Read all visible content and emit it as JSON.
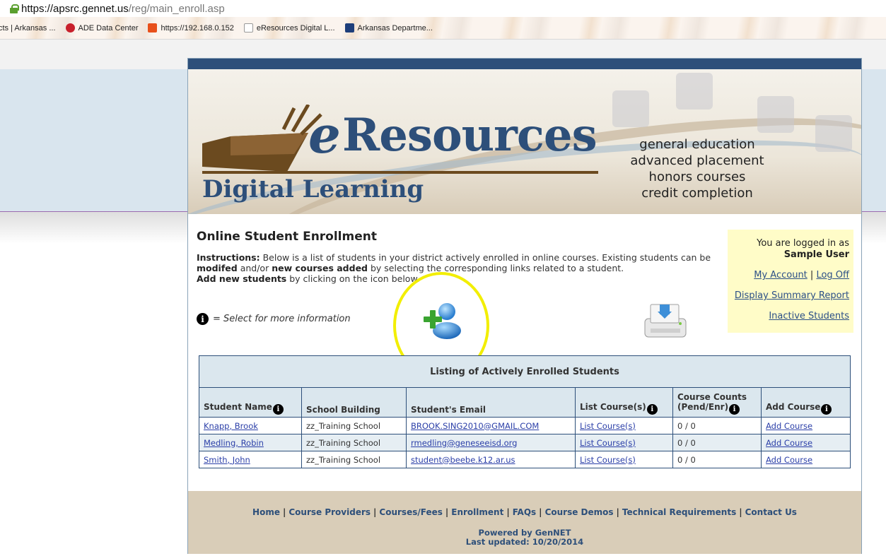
{
  "browser": {
    "url_host": "https://apsrc.gennet.us",
    "url_path": "/reg/main_enroll.asp",
    "bookmarks": [
      {
        "label": "cts | Arkansas ...",
        "icon": "page-icon"
      },
      {
        "label": "ADE Data Center",
        "icon": "ade-icon"
      },
      {
        "label": "https://192.168.0.152",
        "icon": "office-icon"
      },
      {
        "label": "eResources Digital L...",
        "icon": "page-icon"
      },
      {
        "label": "Arkansas Departme...",
        "icon": "arkansas-icon"
      }
    ]
  },
  "banner": {
    "logo_e": "e",
    "logo_resources": "Resources",
    "logo_digital": "Digital Learning",
    "tagline": [
      "general education",
      "advanced placement",
      "honors courses",
      "credit completion"
    ]
  },
  "page": {
    "title": "Online Student Enrollment",
    "instructions_label": "Instructions:",
    "instructions_1": " Below is a list of students in your district actively enrolled in online courses. Existing students can be ",
    "instructions_modified": "modifed",
    "instructions_2": " and/or ",
    "instructions_new_courses": "new courses added",
    "instructions_3": " by selecting the corresponding links related to a student.",
    "instructions_add_new": "Add new students",
    "instructions_4": " by clicking on the icon below.",
    "info_legend": "= Select for more information",
    "info_symbol": "i"
  },
  "login": {
    "logged_in_as": "You are logged in as",
    "user_name": "Sample User",
    "my_account": "My Account",
    "separator": "|",
    "log_off": "Log Off",
    "summary_report": "Display Summary Report",
    "inactive_students": "Inactive Students"
  },
  "table": {
    "caption": "Listing of Actively Enrolled Students",
    "columns": [
      "Student Name",
      "School Building",
      "Student's Email",
      "List Course(s)",
      "Course Counts (Pend/Enr)",
      "Add Course"
    ],
    "rows": [
      {
        "name": "Knapp, Brook",
        "school": "zz_Training School",
        "email": "BROOK.SING2010@GMAIL.COM",
        "list": "List Course(s)",
        "counts": "0 / 0",
        "add": "Add Course"
      },
      {
        "name": "Medling, Robin",
        "school": "zz_Training School",
        "email": "rmedling@geneseeisd.org",
        "list": "List Course(s)",
        "counts": "0 / 0",
        "add": "Add Course"
      },
      {
        "name": "Smith, John",
        "school": "zz_Training School",
        "email": "student@beebe.k12.ar.us",
        "list": "List Course(s)",
        "counts": "0 / 0",
        "add": "Add Course"
      }
    ]
  },
  "footer": {
    "links": [
      "Home",
      "Course Providers",
      "Courses/Fees",
      "Enrollment",
      "FAQs",
      "Course Demos",
      "Technical Requirements",
      "Contact Us"
    ],
    "separator": "|",
    "powered_by": "Powered by GenNET",
    "last_updated": "Last updated: 10/20/2014"
  }
}
